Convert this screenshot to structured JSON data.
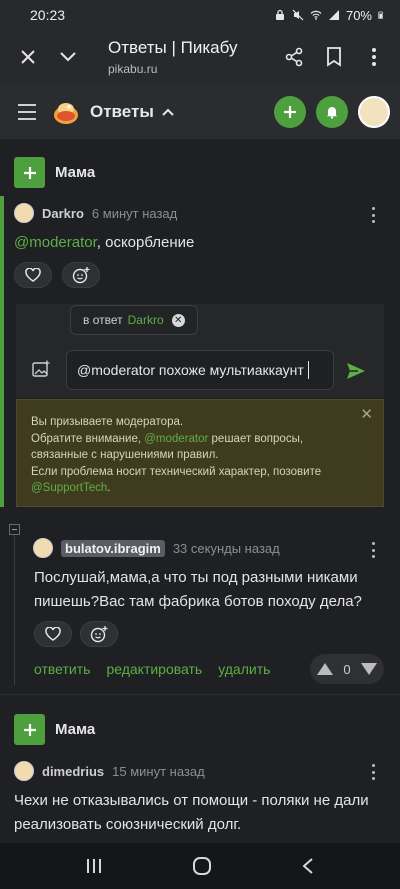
{
  "status_bar": {
    "time": "20:23",
    "battery": "70%"
  },
  "browser": {
    "title": "Ответы | Пикабу",
    "url": "pikabu.ru"
  },
  "site": {
    "section": "Ответы"
  },
  "posts": [
    {
      "name": "Мама"
    },
    {
      "name": "Мама"
    }
  ],
  "comment1": {
    "user": "Darkro",
    "time": "6 минут назад",
    "mention": "@moderator",
    "text": ", оскорбление"
  },
  "reply_form": {
    "reply_to_label": "в ответ",
    "reply_to_user": "Darkro",
    "input_value": "@moderator похоже мультиаккаунт"
  },
  "warning": {
    "line1": "Вы призываете модератора.",
    "line2_pre": "Обратите внимание, ",
    "line2_link": "@moderator",
    "line2_post": " решает вопросы,",
    "line3": "связанные с нарушениями правил.",
    "line4": "Если проблема носит технический характер, позовите",
    "line5_link": "@SupportTech",
    "line5_post": "."
  },
  "comment2": {
    "user": "bulatov.ibragim",
    "time": "33 секунды назад",
    "text": "Послушай,мама,а что ты под разными никами пишешь?Вас там фабрика ботов походу дела?",
    "actions": [
      "ответить",
      "редактировать",
      "удалить"
    ],
    "rating": "0"
  },
  "comment3": {
    "user": "dimedrius",
    "time": "15 минут назад",
    "text": "Чехи не отказывались от помощи - поляки не дали реализовать союзнический долг."
  },
  "icons": {
    "accent": "#4e9f3d",
    "link": "#5fae45",
    "warning_bg": "#3f3b1f"
  }
}
